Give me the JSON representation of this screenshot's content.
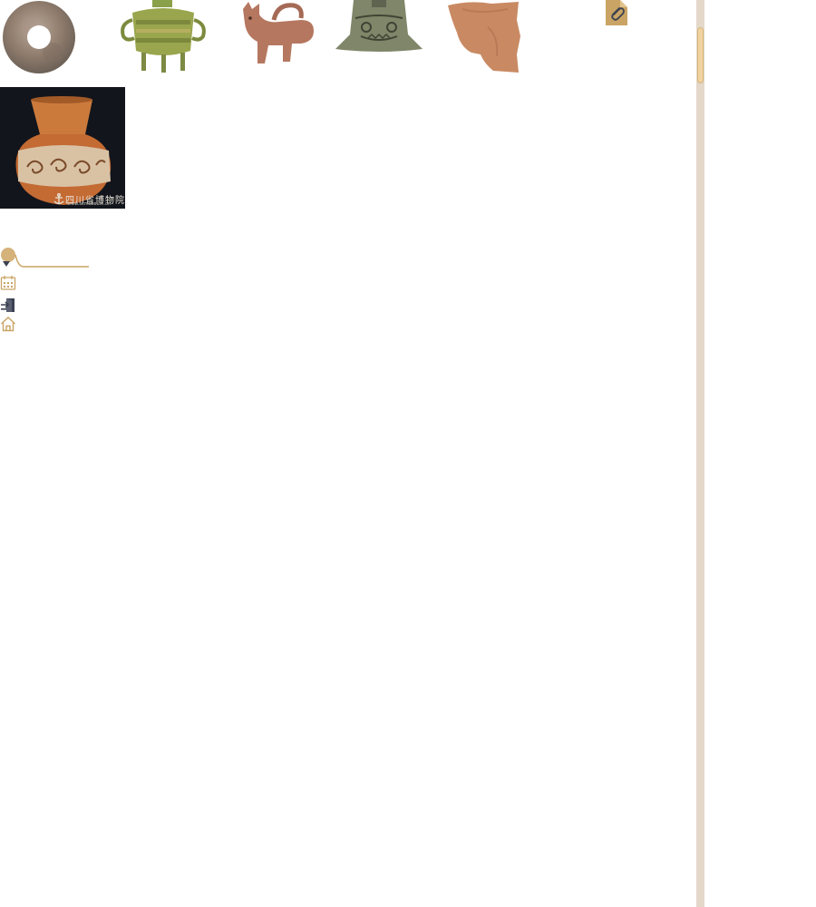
{
  "gallery": {
    "items": [
      {
        "icon": "jade-bi-disc-image"
      },
      {
        "icon": "bronze-ding-vessel-image"
      },
      {
        "icon": "pottery-animal-vessel-image"
      },
      {
        "icon": "bronze-yue-axe-image"
      },
      {
        "icon": "pottery-shard-image"
      },
      {
        "icon": "painted-pottery-jar-image"
      }
    ],
    "watermark": "四川省博物院",
    "watermark_url": "www.scmuseum.cn"
  },
  "toolbar": {
    "attachment_icon": "paperclip-icon"
  },
  "sidebar": {
    "toggle_icon": "user-dropdown-icon",
    "items": [
      {
        "icon": "calendar-icon"
      },
      {
        "icon": "exit-door-icon"
      },
      {
        "icon": "home-icon"
      }
    ]
  },
  "colors": {
    "accent": "#c9a464",
    "scroll_track": "#e3d8ca",
    "scroll_thumb": "#f1d3a0",
    "icon_dark": "#3b4150"
  }
}
